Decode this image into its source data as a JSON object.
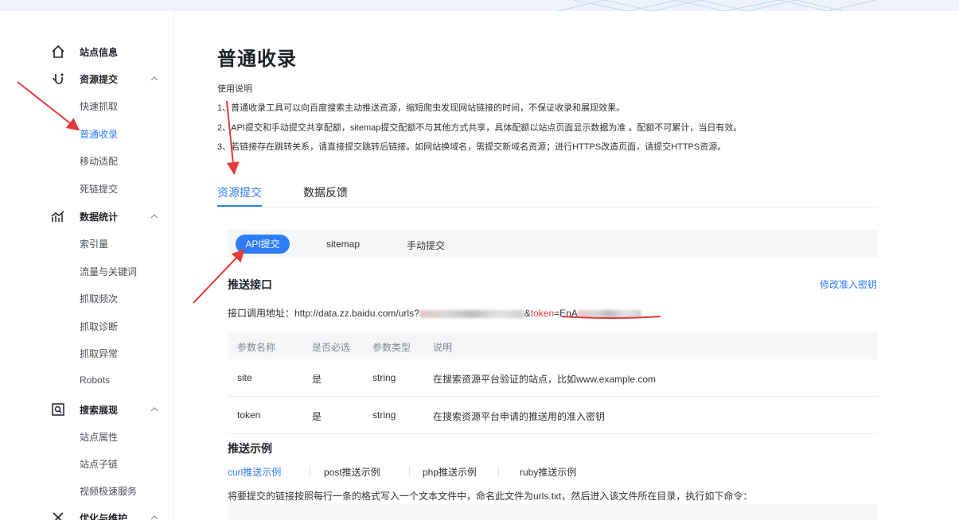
{
  "sidebar": {
    "groups": [
      {
        "label": "站点信息",
        "icon": "home-icon",
        "items": []
      },
      {
        "label": "资源提交",
        "icon": "hook-icon",
        "items": [
          "快速抓取",
          "普通收录",
          "移动适配",
          "死链提交"
        ]
      },
      {
        "label": "数据统计",
        "icon": "chart-icon",
        "items": [
          "索引量",
          "流量与关键词",
          "抓取频次",
          "抓取诊断",
          "抓取异常",
          "Robots"
        ]
      },
      {
        "label": "搜索展现",
        "icon": "search-box-icon",
        "items": [
          "站点属性",
          "站点子链",
          "视频极速服务"
        ]
      },
      {
        "label": "优化与维护",
        "icon": "wrench-icon",
        "items": []
      }
    ],
    "active_item": "普通收录"
  },
  "main": {
    "title": "普通收录",
    "usage_title": "使用说明",
    "usage_lines": [
      "1、普通收录工具可以向百度搜索主动推送资源，缩短爬虫发现网站链接的时间，不保证收录和展现效果。",
      "2、API提交和手动提交共享配额，sitemap提交配额不与其他方式共享，具体配额以站点页面显示数据为准 。配额不可累计，当日有效。",
      "3、若链接存在跳转关系，请直接提交跳转后链接。如网站换域名，需提交新域名资源；进行HTTPS改造页面，请提交HTTPS资源。"
    ],
    "tabs": [
      "资源提交",
      "数据反馈"
    ],
    "subtabs": [
      "API提交",
      "sitemap",
      "手动提交"
    ],
    "push_api_title": "推送接口",
    "modify_key_link": "修改准入密钥",
    "api_prefix": "接口调用地址：http://data.zz.baidu.com/urls?",
    "api_amp": "&",
    "api_token_key": "token",
    "api_eq": "=",
    "api_token_visible": "EnA",
    "table": {
      "headers": [
        "参数名称",
        "是否必选",
        "参数类型",
        "说明"
      ],
      "rows": [
        [
          "site",
          "是",
          "string",
          "在搜索资源平台验证的站点，比如www.example.com"
        ],
        [
          "token",
          "是",
          "string",
          "在搜索资源平台申请的推送用的准入密钥"
        ]
      ]
    },
    "example_title": "推送示例",
    "example_tabs": [
      "curl推送示例",
      "post推送示例",
      "php推送示例",
      "ruby推送示例"
    ],
    "example_desc": "将要提交的链接按照每行一条的格式写入一个文本文件中，命名此文件为urls.txt，然后进入该文件所在目录，执行如下命令："
  },
  "colors": {
    "accent": "#2e7cf6",
    "annotation_red": "#e23b3b"
  }
}
